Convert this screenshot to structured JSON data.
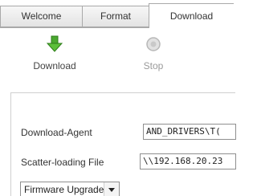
{
  "tabs": [
    {
      "label": "Welcome",
      "active": false
    },
    {
      "label": "Format",
      "active": false
    },
    {
      "label": "Download",
      "active": true
    }
  ],
  "toolbar": {
    "download_label": "Download",
    "download_icon": "green-down-arrow-icon",
    "stop_label": "Stop",
    "stop_icon": "stop-disabled-icon",
    "stop_enabled": false
  },
  "form": {
    "download_agent": {
      "label": "Download-Agent",
      "value": "AND_DRIVERS\\T("
    },
    "scatter_file": {
      "label": "Scatter-loading File",
      "value": "\\\\192.168.20.23"
    },
    "mode": {
      "selected": "Firmware Upgrade"
    }
  },
  "colors": {
    "accent_green": "#4aa82f",
    "disabled_gray": "#b8b8b8",
    "tab_border": "#a9a9a9"
  }
}
